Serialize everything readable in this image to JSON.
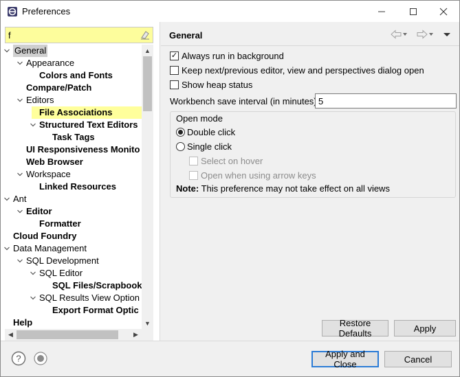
{
  "window": {
    "title": "Preferences",
    "minimize_icon": "minimize-icon",
    "maximize_icon": "maximize-icon",
    "close_icon": "close-icon"
  },
  "filter": {
    "value": "f",
    "clear_icon": "eraser-icon"
  },
  "tree": {
    "items": [
      {
        "label": "General",
        "level": 0,
        "twisty": "down",
        "bold": false,
        "selected": true
      },
      {
        "label": "Appearance",
        "level": 1,
        "twisty": "down",
        "bold": false
      },
      {
        "label": "Colors and Fonts",
        "level": 2,
        "twisty": "",
        "bold": true
      },
      {
        "label": "Compare/Patch",
        "level": 1,
        "twisty": "",
        "bold": true
      },
      {
        "label": "Editors",
        "level": 1,
        "twisty": "down",
        "bold": false
      },
      {
        "label": "File Associations",
        "level": 2,
        "twisty": "",
        "bold": true,
        "highlight": true
      },
      {
        "label": "Structured Text Editors",
        "level": 2,
        "twisty": "down",
        "bold": true
      },
      {
        "label": "Task Tags",
        "level": 3,
        "twisty": "",
        "bold": true
      },
      {
        "label": "UI Responsiveness Monito",
        "level": 1,
        "twisty": "",
        "bold": true
      },
      {
        "label": "Web Browser",
        "level": 1,
        "twisty": "",
        "bold": true
      },
      {
        "label": "Workspace",
        "level": 1,
        "twisty": "down",
        "bold": false
      },
      {
        "label": "Linked Resources",
        "level": 2,
        "twisty": "",
        "bold": true
      },
      {
        "label": "Ant",
        "level": 0,
        "twisty": "down",
        "bold": false
      },
      {
        "label": "Editor",
        "level": 1,
        "twisty": "down",
        "bold": true
      },
      {
        "label": "Formatter",
        "level": 2,
        "twisty": "",
        "bold": true
      },
      {
        "label": "Cloud Foundry",
        "level": 0,
        "twisty": "",
        "bold": true
      },
      {
        "label": "Data Management",
        "level": 0,
        "twisty": "down",
        "bold": false
      },
      {
        "label": "SQL Development",
        "level": 1,
        "twisty": "down",
        "bold": false
      },
      {
        "label": "SQL Editor",
        "level": 2,
        "twisty": "down",
        "bold": false
      },
      {
        "label": "SQL Files/Scrapbook",
        "level": 3,
        "twisty": "",
        "bold": true
      },
      {
        "label": "SQL Results View Option",
        "level": 2,
        "twisty": "down",
        "bold": false
      },
      {
        "label": "Export Format Optic",
        "level": 3,
        "twisty": "",
        "bold": true
      },
      {
        "label": "Help",
        "level": 0,
        "twisty": "",
        "bold": true
      }
    ]
  },
  "page": {
    "title": "General",
    "back_icon": "arrow-left-icon",
    "forward_icon": "arrow-right-icon",
    "menu_icon": "view-menu-icon",
    "options": [
      {
        "label": "Always run in background",
        "checked": true,
        "enabled": true
      },
      {
        "label": "Keep next/previous editor, view and perspectives dialog open",
        "checked": false,
        "enabled": true
      },
      {
        "label": "Show heap status",
        "checked": false,
        "enabled": true
      }
    ],
    "interval_label": "Workbench save interval (in minutes):",
    "interval_value": "5",
    "open_mode": {
      "title": "Open mode",
      "double_click": "Double click",
      "single_click": "Single click",
      "selected": "double",
      "select_on_hover": "Select on hover",
      "open_arrow_keys": "Open when using arrow keys",
      "note_label": "Note:",
      "note_text": "This preference may not take effect on all views"
    },
    "restore_defaults": "Restore Defaults",
    "apply": "Apply"
  },
  "footer": {
    "help_icon": "help-icon",
    "import_icon": "record-icon",
    "apply_and_close": "Apply and Close",
    "cancel": "Cancel"
  },
  "colors": {
    "filter_bg": "#fdfd9c",
    "highlight": "#ffff9c",
    "selection": "#cfcfcf",
    "primary_border": "#2a7bd6"
  }
}
